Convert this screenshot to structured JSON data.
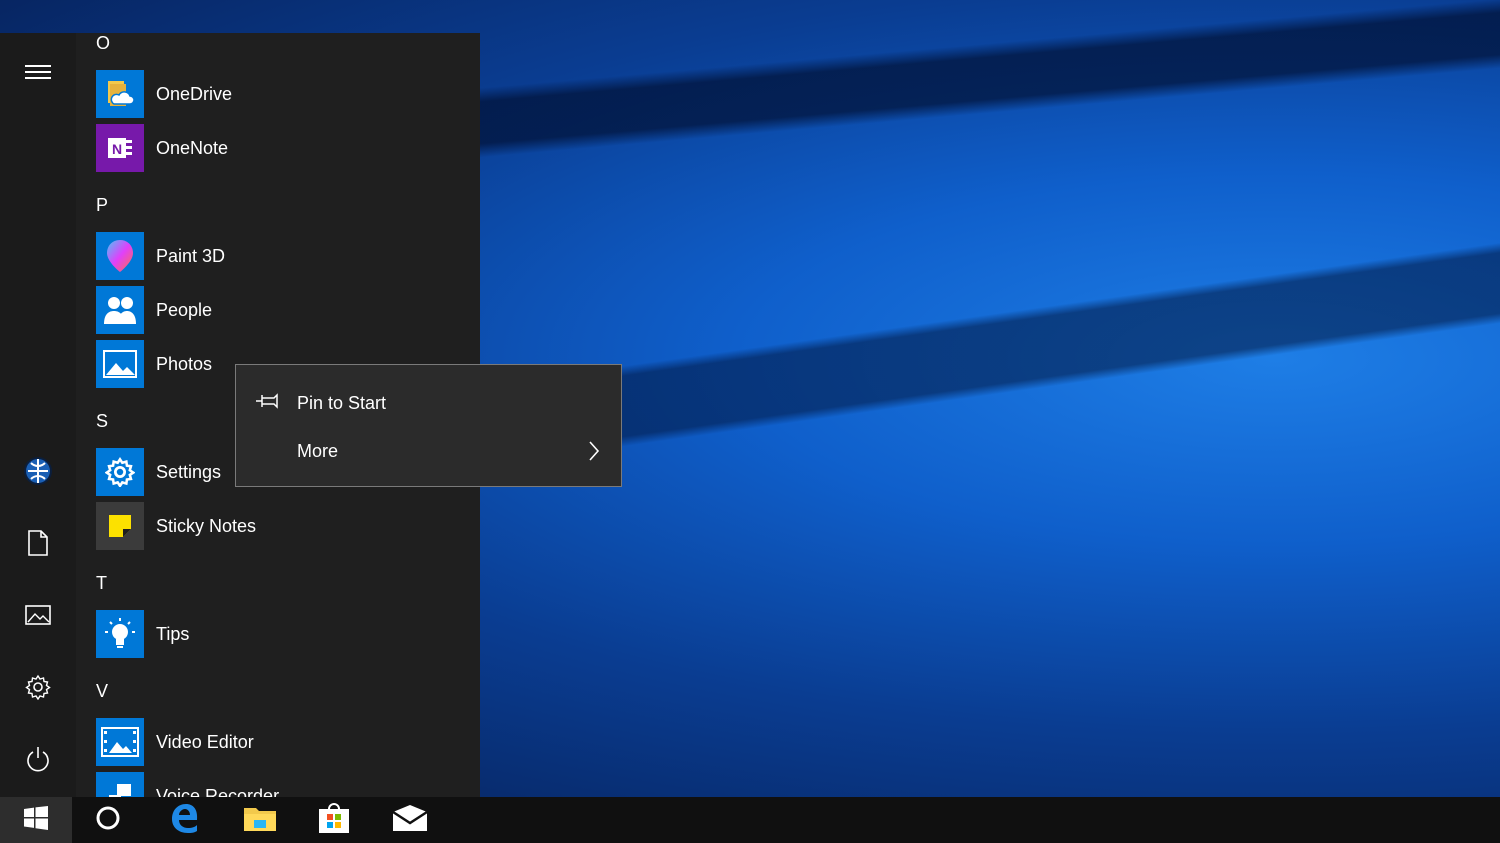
{
  "start_menu": {
    "groups": [
      {
        "letter": "O",
        "apps": [
          {
            "label": "OneDrive",
            "icon": "onedrive-icon"
          },
          {
            "label": "OneNote",
            "icon": "onenote-icon"
          }
        ]
      },
      {
        "letter": "P",
        "apps": [
          {
            "label": "Paint 3D",
            "icon": "paint3d-icon"
          },
          {
            "label": "People",
            "icon": "people-icon"
          },
          {
            "label": "Photos",
            "icon": "photos-icon"
          }
        ]
      },
      {
        "letter": "S",
        "apps": [
          {
            "label": "Settings",
            "icon": "settings-gear-icon"
          },
          {
            "label": "Sticky Notes",
            "icon": "sticky-notes-icon"
          }
        ]
      },
      {
        "letter": "T",
        "apps": [
          {
            "label": "Tips",
            "icon": "lightbulb-icon"
          }
        ]
      },
      {
        "letter": "V",
        "apps": [
          {
            "label": "Video Editor",
            "icon": "video-editor-icon"
          },
          {
            "label": "Voice Recorder",
            "icon": "voice-recorder-icon"
          }
        ]
      }
    ],
    "rail_icons": [
      "hamburger-menu-icon",
      "user-avatar-icon",
      "documents-icon",
      "pictures-icon",
      "settings-icon",
      "power-icon"
    ]
  },
  "context_menu": {
    "items": [
      {
        "label": "Pin to Start",
        "icon": "pin-icon"
      },
      {
        "label": "More",
        "icon": "chevron-right-icon"
      }
    ]
  },
  "taskbar": {
    "icons": [
      "windows-start-icon",
      "cortana-search-icon",
      "edge-browser-icon",
      "file-explorer-icon",
      "microsoft-store-icon",
      "mail-icon"
    ]
  },
  "colors": {
    "accent": "#0078d7",
    "menu_bg": "#1f1f1f",
    "context_bg": "#2b2b2b",
    "taskbar_bg": "#101010"
  }
}
